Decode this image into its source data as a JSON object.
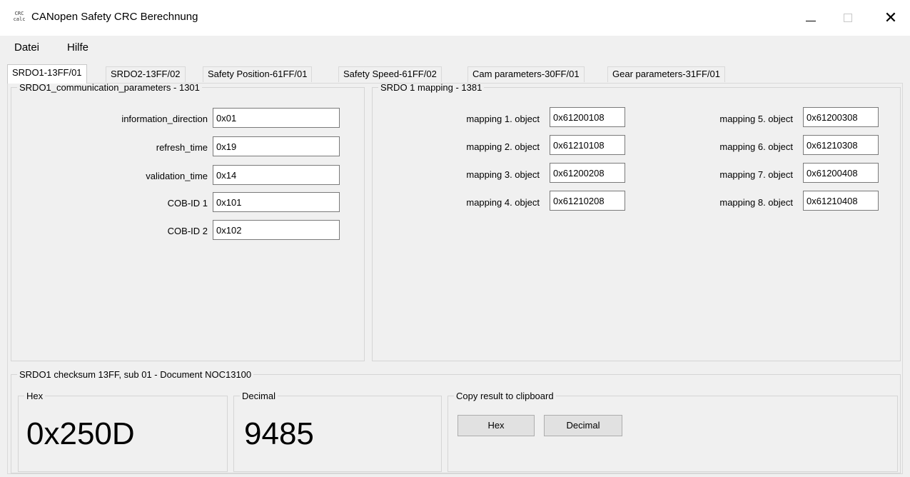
{
  "window": {
    "icon_text_top": "CRC",
    "icon_text_bottom": "calc",
    "title": "CANopen Safety CRC Berechnung",
    "min_glyph": "—",
    "close_glyph": "✕"
  },
  "menu": {
    "items": [
      "Datei",
      "Hilfe"
    ]
  },
  "tabs": [
    {
      "label": "SRDO1-13FF/01",
      "active": true
    },
    {
      "label": "SRDO2-13FF/02",
      "active": false
    },
    {
      "label": "Safety Position-61FF/01",
      "active": false
    },
    {
      "label": "Safety Speed-61FF/02",
      "active": false
    },
    {
      "label": "Cam parameters-30FF/01",
      "active": false
    },
    {
      "label": "Gear parameters-31FF/01",
      "active": false
    }
  ],
  "comm_params": {
    "legend": "SRDO1_communication_parameters - 1301",
    "fields": [
      {
        "label": "information_direction",
        "value": "0x01"
      },
      {
        "label": "refresh_time",
        "value": "0x19"
      },
      {
        "label": "validation_time",
        "value": "0x14"
      },
      {
        "label": "COB-ID 1",
        "value": "0x101"
      },
      {
        "label": "COB-ID 2",
        "value": "0x102"
      }
    ]
  },
  "mapping": {
    "legend": "SRDO 1 mapping - 1381",
    "left": [
      {
        "label": "mapping 1. object",
        "value": "0x61200108"
      },
      {
        "label": "mapping 2. object",
        "value": "0x61210108"
      },
      {
        "label": "mapping 3. object",
        "value": "0x61200208"
      },
      {
        "label": "mapping 4. object",
        "value": "0x61210208"
      }
    ],
    "right": [
      {
        "label": "mapping 5. object",
        "value": "0x61200308"
      },
      {
        "label": "mapping 6. object",
        "value": "0x61210308"
      },
      {
        "label": "mapping 7. object",
        "value": "0x61200408"
      },
      {
        "label": "mapping 8. object",
        "value": "0x61210408"
      }
    ]
  },
  "checksum": {
    "legend": "SRDO1 checksum 13FF, sub 01 - Document NOC13100",
    "hex": {
      "legend": "Hex",
      "value": "0x250D"
    },
    "decimal": {
      "legend": "Decimal",
      "value": "9485"
    },
    "copy": {
      "label": "Copy result to clipboard",
      "hex_button": "Hex",
      "decimal_button": "Decimal"
    }
  }
}
